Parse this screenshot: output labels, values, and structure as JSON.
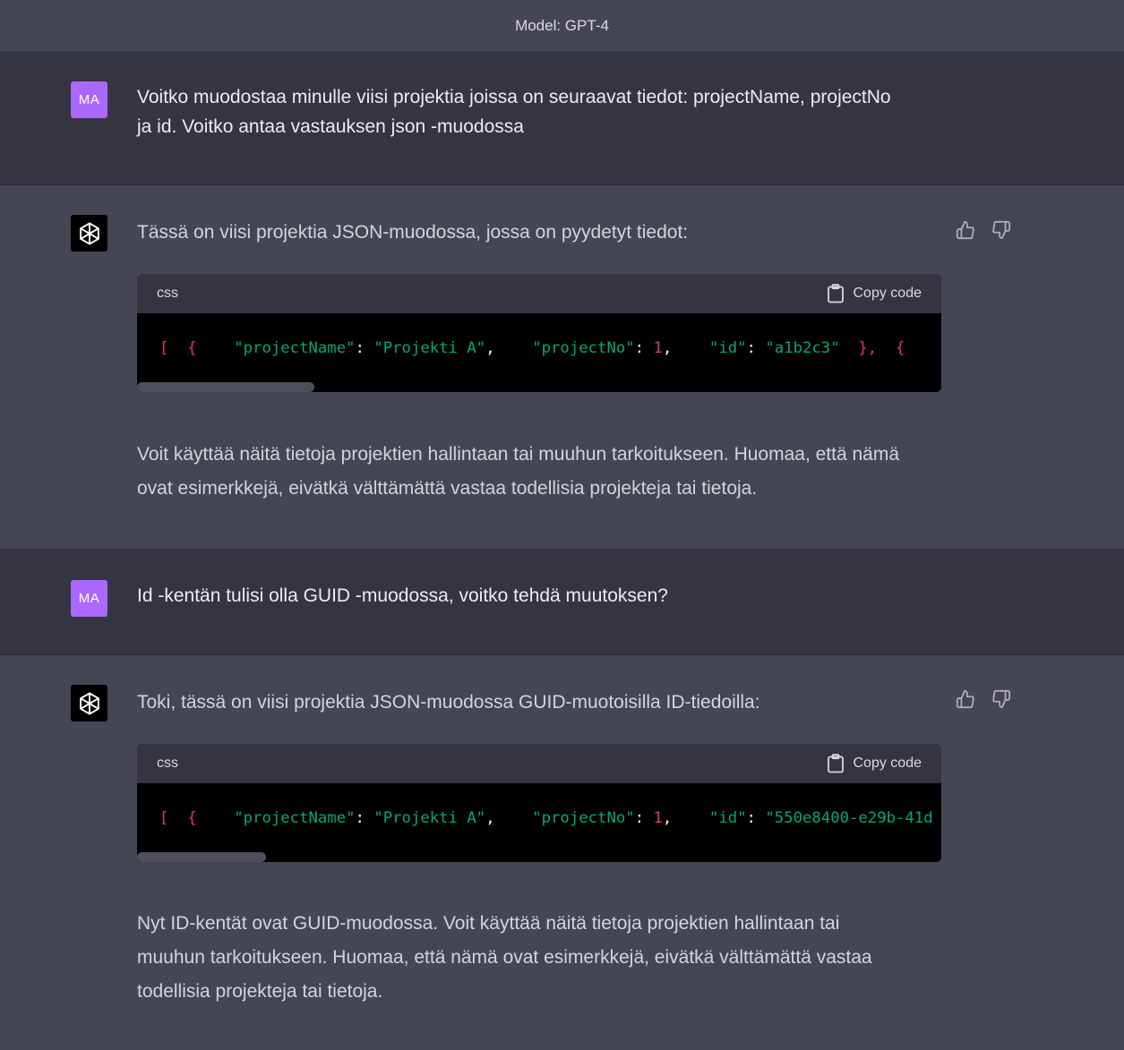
{
  "header": {
    "model_label": "Model: GPT-4"
  },
  "conversation": [
    {
      "role": "user",
      "avatar_initials": "MA",
      "text_lines": [
        "Voitko muodostaa minulle viisi projektia joissa on seuraavat tiedot: projectName, projectNo",
        "ja id. Voitko antaa vastauksen json -muodossa"
      ]
    },
    {
      "role": "assistant",
      "avatar_icon": "openai-logo-icon",
      "intro": "Tässä on viisi projektia JSON-muodossa, jossa on pyydetyt tiedot:",
      "code": {
        "language": "css",
        "copy_label": "Copy code",
        "tokens": [
          "[",
          "{",
          "\"projectName\"",
          ":",
          "\"Projekti A\"",
          ",",
          "\"projectNo\"",
          ":",
          "1",
          ",",
          "\"id\"",
          ":",
          "\"a1b2c3\"",
          "},",
          "{"
        ],
        "scroll_fraction": 0.22
      },
      "outro_lines": [
        "Voit käyttää näitä tietoja projektien hallintaan tai muuhun tarkoitukseen. Huomaa, että nämä",
        "ovat esimerkkejä, eivätkä välttämättä vastaa todellisia projekteja tai tietoja."
      ],
      "feedback": [
        "thumbs-up-icon",
        "thumbs-down-icon"
      ]
    },
    {
      "role": "user",
      "avatar_initials": "MA",
      "text_lines": [
        "Id -kentän tulisi olla GUID -muodossa, voitko tehdä muutoksen?"
      ]
    },
    {
      "role": "assistant",
      "avatar_icon": "openai-logo-icon",
      "intro": "Toki, tässä on viisi projektia JSON-muodossa GUID-muotoisilla ID-tiedoilla:",
      "code": {
        "language": "css",
        "copy_label": "Copy code",
        "tokens": [
          "[",
          "{",
          "\"projectName\"",
          ":",
          "\"Projekti A\"",
          ",",
          "\"projectNo\"",
          ":",
          "1",
          ",",
          "\"id\"",
          ":",
          "\"550e8400-e29b-41d"
        ],
        "scroll_fraction": 0.16
      },
      "outro_lines": [
        "Nyt ID-kentät ovat GUID-muodossa. Voit käyttää näitä tietoja projektien hallintaan tai",
        "muuhun tarkoitukseen. Huomaa, että nämä ovat esimerkkejä, eivätkä välttämättä vastaa",
        "todellisia projekteja tai tietoja."
      ],
      "feedback": [
        "thumbs-up-icon",
        "thumbs-down-icon"
      ]
    }
  ],
  "colors": {
    "user_bg": "#343541",
    "assistant_bg": "#444654",
    "avatar_user": "#ab68ff",
    "code_key": "#00a67d",
    "code_punct": "#df3079"
  }
}
